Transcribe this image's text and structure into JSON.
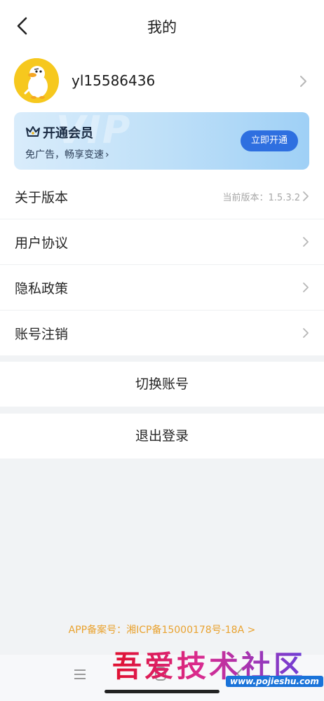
{
  "header": {
    "title": "我的"
  },
  "profile": {
    "username": "yl15586436"
  },
  "vip": {
    "title": "开通会员",
    "subtitle": "免广告，畅享变速",
    "button_label": "立即开通",
    "watermark": "VIP"
  },
  "menu": {
    "items": [
      {
        "label": "关于版本",
        "value": "当前版本：1.5.3.2"
      },
      {
        "label": "用户协议",
        "value": ""
      },
      {
        "label": "隐私政策",
        "value": ""
      },
      {
        "label": "账号注销",
        "value": ""
      }
    ]
  },
  "actions": {
    "switch_account": "切换账号",
    "logout": "退出登录"
  },
  "footer": {
    "icp": "APP备案号：湘ICP备15000178号-18A >"
  },
  "overlay": {
    "watermark_text": "吾爱技术社区",
    "watermark_url": "www.pojieshu.com"
  },
  "colors": {
    "accent": "#2e6fe0",
    "icp": "#e9a22f",
    "avatar_bg": "#f6c81e"
  }
}
